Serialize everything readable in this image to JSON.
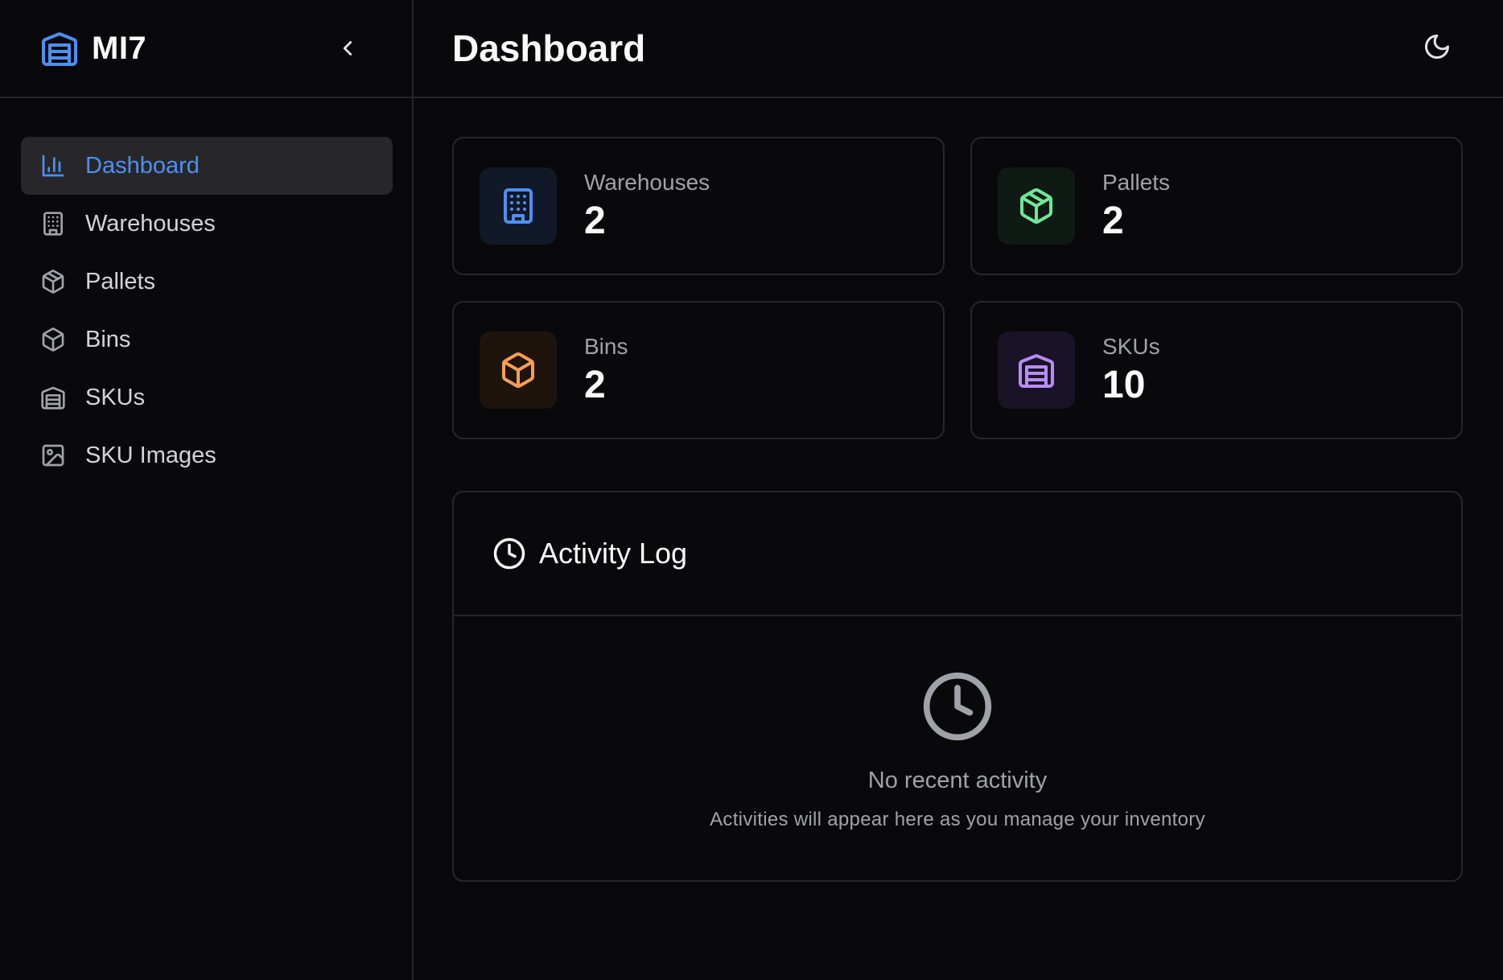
{
  "brand": {
    "name": "MI7",
    "icon": "warehouse-icon",
    "color": "#4f8ff0"
  },
  "sidebar": {
    "items": [
      {
        "label": "Dashboard",
        "icon": "bar-chart-icon",
        "active": true
      },
      {
        "label": "Warehouses",
        "icon": "building-icon",
        "active": false
      },
      {
        "label": "Pallets",
        "icon": "package-icon",
        "active": false
      },
      {
        "label": "Bins",
        "icon": "box-icon",
        "active": false
      },
      {
        "label": "SKUs",
        "icon": "warehouse-icon",
        "active": false
      },
      {
        "label": "SKU Images",
        "icon": "image-icon",
        "active": false
      }
    ]
  },
  "header": {
    "title": "Dashboard",
    "theme_toggle_icon": "moon-icon"
  },
  "stats": [
    {
      "label": "Warehouses",
      "value": "2",
      "icon": "building-icon",
      "color": "#4f8ff0",
      "bg": "#111827"
    },
    {
      "label": "Pallets",
      "value": "2",
      "icon": "package-icon",
      "color": "#6ee79a",
      "bg": "#101a14"
    },
    {
      "label": "Bins",
      "value": "2",
      "icon": "box-icon",
      "color": "#f59e55",
      "bg": "#1f140d"
    },
    {
      "label": "SKUs",
      "value": "10",
      "icon": "warehouse-icon",
      "color": "#b88cf5",
      "bg": "#1a1226"
    }
  ],
  "activity": {
    "title": "Activity Log",
    "empty_title": "No recent activity",
    "empty_subtitle": "Activities will appear here as you manage your inventory"
  }
}
